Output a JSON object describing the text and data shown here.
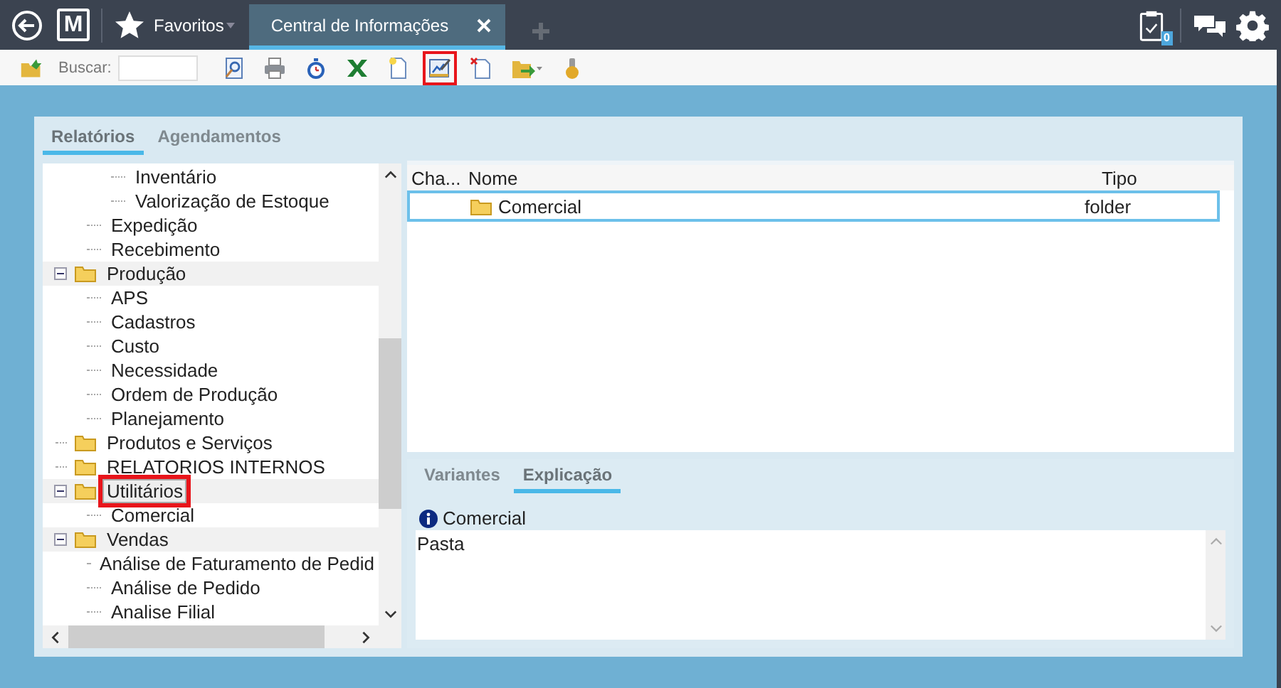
{
  "topbar": {
    "logo": "M",
    "favorites": "Favoritos",
    "tabs": [
      {
        "label": "Central de Informações",
        "selected": true
      }
    ],
    "badge": "0"
  },
  "toolbar": {
    "search_label": "Buscar:",
    "tools": [
      {
        "kind": "open",
        "annotated": false
      },
      {
        "kind": "preview",
        "annotated": false
      },
      {
        "kind": "print",
        "annotated": false
      },
      {
        "kind": "timer",
        "annotated": false
      },
      {
        "kind": "excel",
        "annotated": false
      },
      {
        "kind": "new",
        "annotated": false
      },
      {
        "kind": "edit",
        "annotated": true
      },
      {
        "kind": "delete",
        "annotated": false
      },
      {
        "kind": "export",
        "annotated": false
      },
      {
        "kind": "plugin",
        "annotated": false
      }
    ]
  },
  "left_tabs": [
    {
      "label": "Relatórios",
      "selected": true
    },
    {
      "label": "Agendamentos",
      "selected": false
    }
  ],
  "tree": [
    {
      "children": [
        {
          "children": [
            {
              "label": "Inventário",
              "kind": "report",
              "selected": false,
              "annotated": false
            },
            {
              "label": "Valorização de Estoque",
              "kind": "report",
              "selected": false,
              "annotated": false
            }
          ]
        },
        {
          "label": "Expedição",
          "kind": "report",
          "selected": false,
          "annotated": false
        },
        {
          "label": "Recebimento",
          "kind": "report",
          "selected": false,
          "annotated": false
        }
      ]
    },
    {
      "label": "Produção",
      "kind": "folder",
      "expanded": true,
      "selected": false,
      "annotated": false,
      "children": [
        {
          "label": "APS",
          "kind": "report",
          "selected": false,
          "annotated": false
        },
        {
          "label": "Cadastros",
          "kind": "report",
          "selected": false,
          "annotated": false
        },
        {
          "label": "Custo",
          "kind": "report",
          "selected": false,
          "annotated": false
        },
        {
          "label": "Necessidade",
          "kind": "report",
          "selected": false,
          "annotated": false
        },
        {
          "label": "Ordem de Produção",
          "kind": "report",
          "selected": false,
          "annotated": false
        },
        {
          "label": "Planejamento",
          "kind": "report",
          "selected": false,
          "annotated": false
        }
      ]
    },
    {
      "label": "Produtos e Serviços",
      "kind": "folder",
      "selected": false,
      "annotated": false
    },
    {
      "label": "RELATORIOS INTERNOS",
      "kind": "folder",
      "selected": false,
      "annotated": false
    },
    {
      "label": "Utilitários",
      "kind": "folder",
      "expanded": true,
      "selected": true,
      "annotated": true,
      "children": [
        {
          "label": "Comercial",
          "kind": "report",
          "selected": false,
          "annotated": false
        }
      ]
    },
    {
      "label": "Vendas",
      "kind": "folder",
      "expanded": true,
      "selected": false,
      "annotated": false,
      "children": [
        {
          "label": "Análise de Faturamento de Pedid",
          "kind": "report",
          "selected": false,
          "annotated": false
        },
        {
          "label": "Análise de Pedido",
          "kind": "report",
          "selected": false,
          "annotated": false
        },
        {
          "label": "Analise Filial",
          "kind": "report",
          "selected": false,
          "annotated": false
        }
      ]
    }
  ],
  "list": {
    "columns": [
      "Cha...",
      "Nome",
      "Tipo"
    ],
    "rows": [
      {
        "name": "Comercial",
        "type": "folder",
        "selected": true
      }
    ]
  },
  "detail_tabs": [
    {
      "label": "Variantes",
      "selected": false
    },
    {
      "label": "Explicação",
      "selected": true
    }
  ],
  "detail": {
    "title": "Comercial",
    "text": "Pasta"
  }
}
